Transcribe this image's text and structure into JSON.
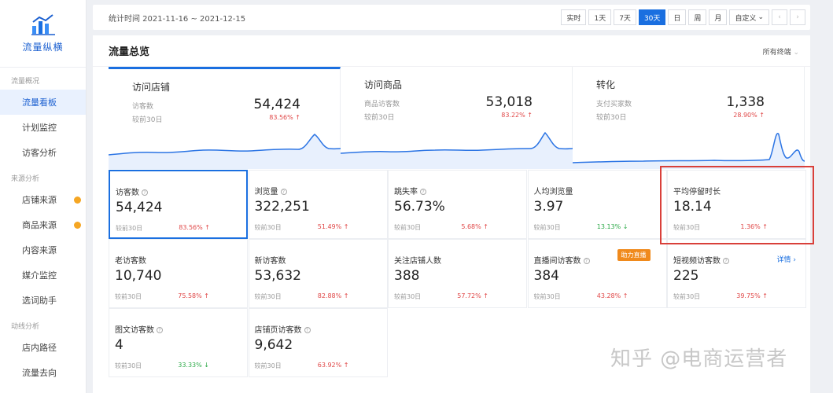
{
  "sidebar": {
    "title": "流量纵横",
    "groups": [
      {
        "label": "流量概况",
        "items": [
          {
            "label": "流量看板",
            "active": true
          },
          {
            "label": "计划监控"
          },
          {
            "label": "访客分析"
          }
        ]
      },
      {
        "label": "来源分析",
        "items": [
          {
            "label": "店铺来源",
            "dot": true
          },
          {
            "label": "商品来源",
            "dot": true
          },
          {
            "label": "内容来源"
          },
          {
            "label": "媒介监控"
          },
          {
            "label": "选词助手"
          }
        ]
      },
      {
        "label": "动线分析",
        "items": [
          {
            "label": "店内路径"
          },
          {
            "label": "流量去向"
          }
        ]
      }
    ]
  },
  "topbar": {
    "stat_time": "统计时间 2021-11-16 ~ 2021-12-15",
    "ranges": [
      "实时",
      "1天",
      "7天",
      "30天",
      "日",
      "周",
      "月",
      "自定义"
    ],
    "active_range": "30天",
    "custom_suffix": "⌄",
    "prev": "‹",
    "next": "›"
  },
  "panel": {
    "title": "流量总览",
    "terminal": "所有终端"
  },
  "overview": [
    {
      "title": "访问店铺",
      "sub": "访客数",
      "value": "54,424",
      "compare": "较前30日",
      "pct": "83.56%",
      "trend": "up"
    },
    {
      "title": "访问商品",
      "sub": "商品访客数",
      "value": "53,018",
      "compare": "较前30日",
      "pct": "83.22%",
      "trend": "up"
    },
    {
      "title": "转化",
      "sub": "支付买家数",
      "value": "1,338",
      "compare": "较前30日",
      "pct": "28.90%",
      "trend": "up"
    }
  ],
  "metrics": [
    {
      "label": "访客数",
      "help": true,
      "value": "54,424",
      "compare": "较前30日",
      "pct": "83.56%",
      "trend": "up",
      "selected": true
    },
    {
      "label": "浏览量",
      "help": true,
      "value": "322,251",
      "compare": "较前30日",
      "pct": "51.49%",
      "trend": "up"
    },
    {
      "label": "跳失率",
      "help": true,
      "value": "56.73%",
      "compare": "较前30日",
      "pct": "5.68%",
      "trend": "up"
    },
    {
      "label": "人均浏览量",
      "help": false,
      "value": "3.97",
      "compare": "较前30日",
      "pct": "13.13%",
      "trend": "down"
    },
    {
      "label": "平均停留时长",
      "help": false,
      "value": "18.14",
      "compare": "较前30日",
      "pct": "1.36%",
      "trend": "up"
    },
    {
      "label": "老访客数",
      "help": false,
      "value": "10,740",
      "compare": "较前30日",
      "pct": "75.58%",
      "trend": "up"
    },
    {
      "label": "新访客数",
      "help": false,
      "value": "53,632",
      "compare": "较前30日",
      "pct": "82.88%",
      "trend": "up"
    },
    {
      "label": "关注店铺人数",
      "help": false,
      "value": "388",
      "compare": "较前30日",
      "pct": "57.72%",
      "trend": "up"
    },
    {
      "label": "直播间访客数",
      "help": true,
      "value": "384",
      "compare": "较前30日",
      "pct": "43.28%",
      "trend": "up",
      "badge": "助力直播"
    },
    {
      "label": "短视频访客数",
      "help": true,
      "value": "225",
      "compare": "较前30日",
      "pct": "39.75%",
      "trend": "up",
      "detail": "详情 ›"
    },
    {
      "label": "图文访客数",
      "help": true,
      "value": "4",
      "compare": "较前30日",
      "pct": "33.33%",
      "trend": "down"
    },
    {
      "label": "店铺页访客数",
      "help": true,
      "value": "9,642",
      "compare": "较前30日",
      "pct": "63.92%",
      "trend": "up"
    }
  ],
  "watermark": "知乎 @电商运营者",
  "colors": {
    "accent": "#1a6fe0",
    "up": "#e04848",
    "down": "#2eaa4a",
    "badge": "#f08a1c",
    "highlight": "#d9403a"
  }
}
